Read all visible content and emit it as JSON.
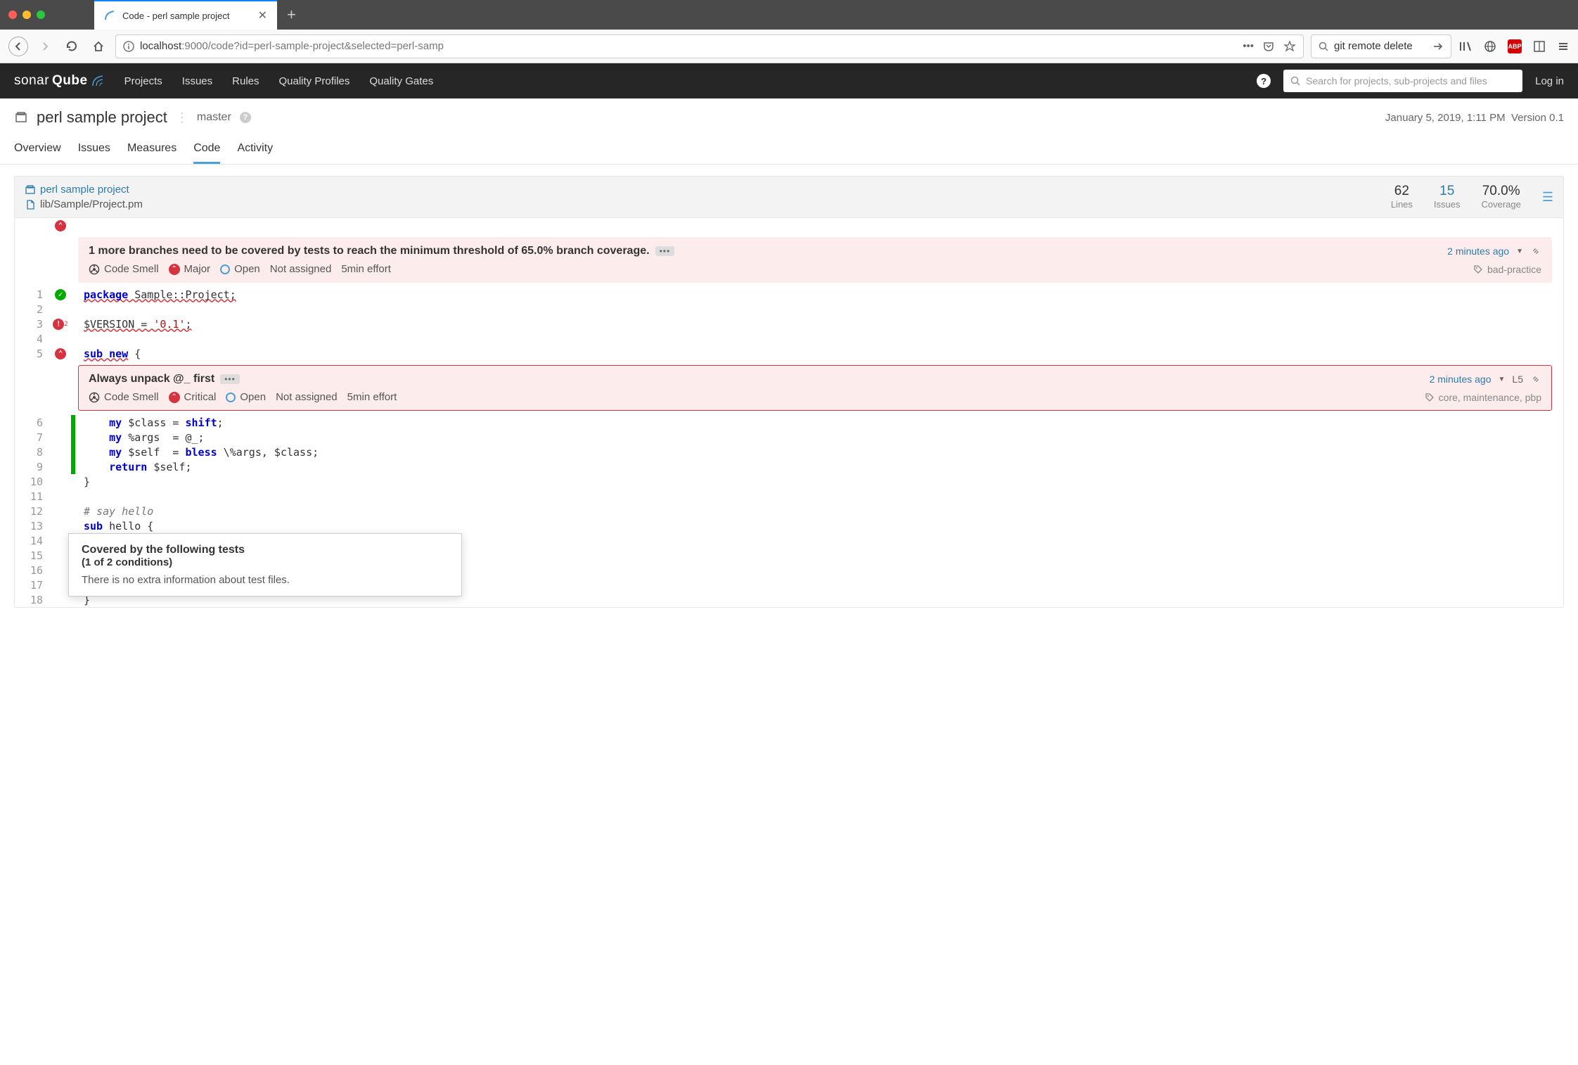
{
  "browser": {
    "tab_title": "Code - perl sample project",
    "url_host": "localhost",
    "url_rest": ":9000/code?id=perl-sample-project&selected=perl-samp",
    "search_value": "git remote delete"
  },
  "sq": {
    "logo_a": "sonar",
    "logo_b": "Qube",
    "nav": {
      "projects": "Projects",
      "issues": "Issues",
      "rules": "Rules",
      "qprofiles": "Quality Profiles",
      "qgates": "Quality Gates"
    },
    "search_placeholder": "Search for projects, sub-projects and files",
    "login": "Log in"
  },
  "project": {
    "name": "perl sample project",
    "branch": "master",
    "date": "January 5, 2019, 1:11 PM",
    "version": "Version 0.1",
    "tabs": {
      "overview": "Overview",
      "issues": "Issues",
      "measures": "Measures",
      "code": "Code",
      "activity": "Activity"
    }
  },
  "code": {
    "breadcrumb_project": "perl sample project",
    "breadcrumb_file": "lib/Sample/Project.pm",
    "stats": {
      "lines_val": "62",
      "lines_label": "Lines",
      "issues_val": "15",
      "issues_label": "Issues",
      "coverage_val": "70.0%",
      "coverage_label": "Coverage"
    }
  },
  "issue1": {
    "title": "1 more branches need to be covered by tests to reach the minimum threshold of 65.0% branch coverage.",
    "type": "Code Smell",
    "severity": "Major",
    "status": "Open",
    "assignee": "Not assigned",
    "effort": "5min effort",
    "age": "2 minutes ago",
    "tags": "bad-practice"
  },
  "issue2": {
    "title": "Always unpack @_ first",
    "type": "Code Smell",
    "severity": "Critical",
    "status": "Open",
    "assignee": "Not assigned",
    "effort": "5min effort",
    "age": "2 minutes ago",
    "line": "L5",
    "tags": "core, maintenance, pbp"
  },
  "lines": {
    "l1a": "package",
    "l1b": " Sample::Project;",
    "l3a": "$VERSION = ",
    "l3b": "'0.1'",
    "l3c": ";",
    "l5a": "sub",
    "l5b": " new",
    "l5c": " {",
    "l6a": "    my",
    "l6b": " $class = ",
    "l6c": "shift",
    "l6d": ";",
    "l7a": "    my",
    "l7b": " %args  = @_;",
    "l8a": "    my",
    "l8b": " $self  = ",
    "l8c": "bless",
    "l8d": " \\%args, $class;",
    "l9a": "    return",
    "l9b": " $self;",
    "l10": "}",
    "l12": "# say hello",
    "l13a": "sub",
    "l13b": " hello {",
    "l18": "}"
  },
  "tooltip": {
    "title": "Covered by the following tests",
    "sub": "(1 of 2 conditions)",
    "body": "There is no extra information about test files."
  }
}
